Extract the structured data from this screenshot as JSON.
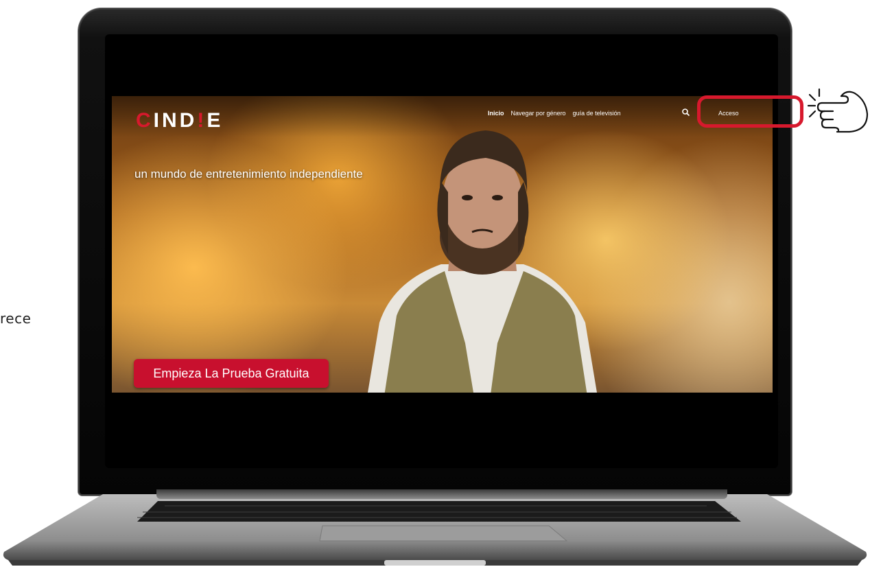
{
  "side_text": "rece",
  "site": {
    "logo_prefix": "C",
    "logo_mid": "IND",
    "logo_bang": "!",
    "logo_suffix": "E",
    "nav": [
      {
        "label": "Inicio",
        "active": true
      },
      {
        "label": "Navegar por género",
        "active": false
      },
      {
        "label": "guía de televisión",
        "active": false
      }
    ],
    "login_label": "Acceso",
    "tagline": "un mundo de entretenimiento independiente",
    "cta_label": "Empieza La Prueba Gratuita"
  },
  "colors": {
    "brand_red": "#c8102e",
    "highlight_red": "#d7192d"
  },
  "icons": [
    "search-icon",
    "pointing-hand-icon"
  ]
}
